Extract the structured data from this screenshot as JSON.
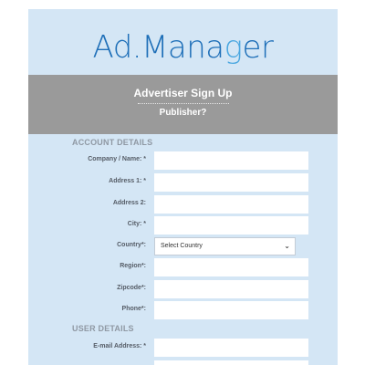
{
  "brand": {
    "part1": "Ad.M",
    "part2": "ana",
    "part3": "g",
    "part4": "er"
  },
  "header": {
    "title": "Advertiser Sign Up",
    "link": "Publisher?"
  },
  "account_section": {
    "heading": "ACCOUNT DETAILS",
    "fields": [
      {
        "label": "Company / Name: *",
        "value": ""
      },
      {
        "label": "Address 1: *",
        "value": ""
      },
      {
        "label": "Address 2:",
        "value": ""
      },
      {
        "label": "City: *",
        "value": ""
      },
      {
        "label": "Country*:",
        "value": "Select Country"
      },
      {
        "label": "Region*:",
        "value": ""
      },
      {
        "label": "Zipcode*:",
        "value": ""
      },
      {
        "label": "Phone*:",
        "value": ""
      }
    ]
  },
  "user_section": {
    "heading": "USER DETAILS",
    "fields": [
      {
        "label": "E-mail Address: *",
        "value": ""
      }
    ]
  }
}
